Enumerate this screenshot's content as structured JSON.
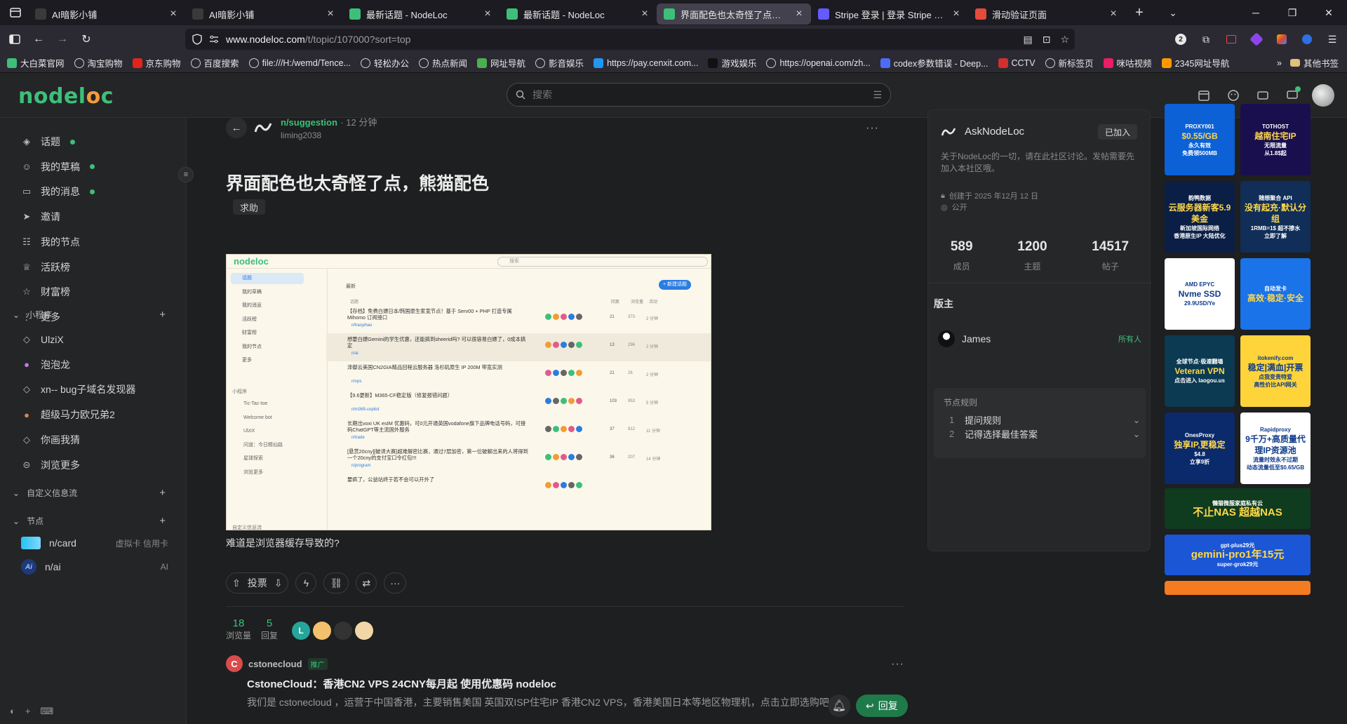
{
  "tabs": [
    {
      "label": "AI暗影小铺",
      "favicon_color": "#3a3a3a",
      "active": false
    },
    {
      "label": "AI暗影小铺",
      "favicon_color": "#3a3a3a",
      "active": false
    },
    {
      "label": "最新话题 - NodeLoc",
      "favicon_color": "#3dbf7a",
      "active": false
    },
    {
      "label": "最新话题 - NodeLoc",
      "favicon_color": "#3dbf7a",
      "active": false
    },
    {
      "label": "界面配色也太奇怪了点，熊猫配",
      "favicon_color": "#3dbf7a",
      "active": true
    },
    {
      "label": "Stripe 登录 | 登录 Stripe 管理平",
      "favicon_color": "#635bff",
      "active": false
    },
    {
      "label": "滑动验证页面",
      "favicon_color": "#e34b3b",
      "active": false
    }
  ],
  "url": {
    "host": "www.nodeloc.com",
    "path": "/t/topic/107000?sort=top"
  },
  "toolbar_badge": "2",
  "bookmarks": [
    {
      "label": "大白菜官网",
      "color": "#3dbf7a"
    },
    {
      "label": "淘宝购物",
      "color": ""
    },
    {
      "label": "京东购物",
      "color": "#e1251b",
      "glyph": "JD"
    },
    {
      "label": "百度搜索",
      "color": ""
    },
    {
      "label": "file:///H:/wemd/Tence...",
      "color": ""
    },
    {
      "label": "轻松办公",
      "color": ""
    },
    {
      "label": "热点新闻",
      "color": ""
    },
    {
      "label": "网址导航",
      "color": "#4caf50"
    },
    {
      "label": "影音娱乐",
      "color": ""
    },
    {
      "label": "https://pay.cenxit.com...",
      "color": "#2196f3"
    },
    {
      "label": "游戏娱乐",
      "color": "#111"
    },
    {
      "label": "https://openai.com/zh...",
      "color": ""
    },
    {
      "label": "codex参数错误 - Deep...",
      "color": "#4a6cf7"
    },
    {
      "label": "CCTV",
      "color": "#d32f2f",
      "glyph": "C"
    },
    {
      "label": "新标签页",
      "color": ""
    },
    {
      "label": "咪咕视频",
      "color": "#e91e63"
    },
    {
      "label": "2345网址导航",
      "color": "#ff9800"
    }
  ],
  "other_bookmarks": "其他书签",
  "site": {
    "logo_a": "nodel",
    "logo_b": "o",
    "logo_c": "c",
    "search_placeholder": "搜索"
  },
  "sidebar": {
    "main": [
      {
        "label": "话题",
        "icon": "layers-icon",
        "dot": true
      },
      {
        "label": "我的草稿",
        "icon": "user-icon",
        "dot": true
      },
      {
        "label": "我的消息",
        "icon": "inbox-icon",
        "dot": true
      },
      {
        "label": "邀请",
        "icon": "send-icon",
        "dot": false
      },
      {
        "label": "我的节点",
        "icon": "users-icon",
        "dot": false
      },
      {
        "label": "活跃榜",
        "icon": "trophy-icon",
        "dot": false
      },
      {
        "label": "财富榜",
        "icon": "star-icon",
        "dot": false
      },
      {
        "label": "更多",
        "icon": "more-vertical-icon",
        "dot": false
      }
    ],
    "section_apps": "小程序",
    "apps": [
      "UlziX",
      "泡泡龙",
      "xn-- bug子域名发现器",
      "超级马力欧兄弟2",
      "你画我猜",
      "浏览更多"
    ],
    "section_feeds": "自定义信息流",
    "section_nodes": "节点",
    "nodes": [
      {
        "label": "n/card",
        "desc": "虚拟卡 信用卡"
      },
      {
        "label": "n/ai",
        "desc": "AI"
      }
    ]
  },
  "topic": {
    "category": "n/suggestion",
    "time": "· 12 分钟",
    "author": "liming2038",
    "title": "界面配色也太奇怪了点，熊猫配色",
    "tag": "求助",
    "body": "难道是浏览器缓存导致的?",
    "vote_label": "投票",
    "views": "18",
    "views_label": "浏览量",
    "replies": "5",
    "replies_label": "回复"
  },
  "embedded": {
    "logo": "nodeloc",
    "search": "搜索",
    "nav": [
      "话题",
      "我的草稿",
      "我的消息",
      "活跃榜",
      "财富榜",
      "我的节点",
      "更多"
    ],
    "apps_header": "小程序",
    "apps": [
      "Tic-Tac-toe",
      "Welcome bot",
      "UlziX",
      "问道：今日精仙路",
      "星球探索",
      "浏览更多"
    ],
    "feeds_header": "自定义信息流",
    "sort": "最新",
    "new_btn": "+ 新建话题",
    "cols": [
      "话题",
      "回复",
      "浏览量",
      "活动"
    ],
    "rows": [
      {
        "title": "【存档】免费白嫖日本/韩国原生家宽节点！基于 Serv00 + PHP 打造专属 Mihomo 订阅接口",
        "node": "n/haoyihao",
        "replies": "21",
        "views": "373",
        "time": "2 分钟"
      },
      {
        "title": "想要白嫖Gemini的学生优惠，还能搞到sheerid吗? 可以很容易白嫖了，0成本搞定",
        "node": "n/ai",
        "replies": "13",
        "views": "296",
        "time": "2 分钟"
      },
      {
        "title": "泽御云美国CN2GIA精品回程云服务器 洛杉矶原生 IP 200M 带宽实测",
        "node": "n/vps",
        "replies": "21",
        "views": "26",
        "time": "2 分钟"
      },
      {
        "title": "【9.6更新】M365-CF稳定版（修复报错问题）",
        "node": "n/m365-copilot",
        "replies": "103",
        "views": "953",
        "time": "5 分钟"
      },
      {
        "title": "长期出voxi UK esIM 优惠码，可0元开通英国vodafone旗下品牌电话号码，可接码ChatGPT等主流国外服务",
        "node": "n/trade",
        "replies": "37",
        "views": "812",
        "time": "11 分钟"
      },
      {
        "title": "[悬赏20cny][破译大赛]超难解密比赛，通过7层加密，第一位破解出来的人将得到一个20cny的支付宝口令红包!!!",
        "node": "n/program",
        "replies": "36",
        "views": "207",
        "time": "14 分钟"
      },
      {
        "title": "要疯了，公益站终于若不会可以开外了",
        "node": "",
        "replies": "",
        "views": "",
        "time": ""
      }
    ]
  },
  "ad": {
    "name": "cstonecloud",
    "badge": "推广",
    "title": "CstoneCloud：香港CN2 VPS 24CNY每月起 使用优惠码 nodeloc",
    "text": "我们是 cstonecloud ，运营于中国香港，主要销售美国 英国双ISP住宅IP 香港CN2 VPS，香港美国日本等地区物理机，点击立即选购吧！~",
    "reply": "回复"
  },
  "community": {
    "name": "AskNodeLoc",
    "joined": "已加入",
    "desc": "关于NodeLoc的一切，请在此社区讨论。发帖需要先加入本社区哦。",
    "created": "创建于 2025 年12月 12 日",
    "visibility": "公开",
    "stats": [
      {
        "n": "589",
        "l": "成员"
      },
      {
        "n": "1200",
        "l": "主题"
      },
      {
        "n": "14517",
        "l": "帖子"
      }
    ],
    "mods_label": "版主",
    "mod": {
      "name": "James",
      "role": "所有人"
    },
    "rules_label": "节点规则",
    "rules": [
      {
        "no": "1",
        "text": "提问规则"
      },
      {
        "no": "2",
        "text": "记得选择最佳答案"
      }
    ]
  },
  "ads_sidebar": [
    {
      "line1": "PROXY001",
      "line2": "$0.55/GB",
      "line3": "永久有效",
      "line4": "免费领500MB",
      "bg": "#0c61d6"
    },
    {
      "line1": "TOTHOST",
      "line2": "越南住宅IP",
      "line3": "无限流量",
      "line4": "从1.8$起",
      "bg": "#1a0f4e"
    },
    {
      "line1": "韵鸭数据",
      "line2": "云服务器新客5.9美金",
      "line3": "新加坡国际网络",
      "line4": "香港原生IP 大陆优化",
      "bg": "#0b1f46"
    },
    {
      "line1": "随想聚合 API",
      "line2": "没有起充·默认分组",
      "line3": "1RMB=1$ 超不掺水",
      "line4": "立即了解",
      "bg": "#102e58"
    },
    {
      "line1": "AMD EPYC",
      "line2": "Nvme SSD",
      "line3": "29.9USD/Ye",
      "line4": "",
      "bg": "#ffffff"
    },
    {
      "line1": "自动发卡",
      "line2": "高效·稳定·安全",
      "line3": "",
      "line4": "",
      "bg": "#1a73e8"
    },
    {
      "line1": "全球节点·极速翻墙",
      "line2": "Veteran VPN",
      "line3": "点击进入 laogou.us",
      "line4": "",
      "bg": "#0b3a52"
    },
    {
      "line1": "itokenify.com",
      "line2": "稳定|满血|开票",
      "line3": "点我变贵特爱",
      "line4": "高性价比API网关",
      "bg": "#ffd43b"
    },
    {
      "line1": "OnesProxy",
      "line2": "独享IP,更稳定",
      "line3": "$4.8",
      "line4": "立享9折",
      "bg": "#0a2a6b"
    },
    {
      "line1": "Rapidproxy",
      "line2": "9千万+高质量代理IP资源池",
      "line3": "流量时效永不过期",
      "line4": "动态流量低至$0.65/GB",
      "bg": "#ffffff"
    },
    {
      "line1": "懒猫微服家庭私有云",
      "line2": "不止NAS 超越NAS",
      "bg": "#0f3c1e"
    },
    {
      "line1": "gpt-plus29元",
      "line2": "gemini-pro1年15元",
      "line3": "super-grok29元",
      "bg": "#1a56d6"
    }
  ]
}
